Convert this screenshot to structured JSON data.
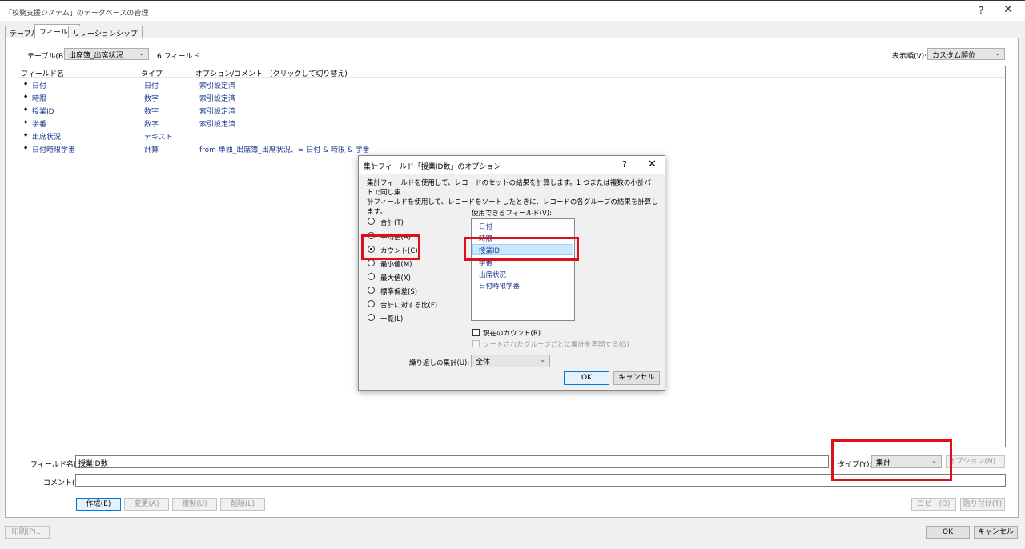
{
  "window": {
    "title": "「校務支援システム」のデータベースの管理",
    "help": "?",
    "close": "✕"
  },
  "tabs": [
    "テーブル",
    "フィールド",
    "リレーションシップ"
  ],
  "table_label": "テーブル(B):",
  "table_value": "出席簿_出席状況",
  "field_count": "6 フィールド",
  "sort_label": "表示順(V):",
  "sort_value": "カスタム順位",
  "list": {
    "headers": [
      "フィールド名",
      "タイプ",
      "オプション/コメント　(クリックして切り替え)"
    ],
    "rows": [
      {
        "name": "日付",
        "type": "日付",
        "option": "索引設定済"
      },
      {
        "name": "時限",
        "type": "数字",
        "option": "索引設定済"
      },
      {
        "name": "授業ID",
        "type": "数字",
        "option": "索引設定済"
      },
      {
        "name": "学番",
        "type": "数字",
        "option": "索引設定済"
      },
      {
        "name": "出席状況",
        "type": "テキスト",
        "option": ""
      },
      {
        "name": "日付時限学番",
        "type": "計算",
        "option": "from 単独_出席簿_出席状況、= 日付 & 時限 & 学番"
      }
    ]
  },
  "bottom": {
    "field_name_label": "フィールド名(F):",
    "field_name_value": "授業ID数",
    "type_label": "タイプ(Y):",
    "type_value": "集計",
    "options_button": "オプション(N)...",
    "comment_label": "コメント(C):",
    "comment_value": "",
    "create": "作成(E)",
    "change": "変更(A)",
    "duplicate": "複製(U)",
    "delete": "削除(L)",
    "copy": "コピー(O)",
    "paste": "貼り付け(T)",
    "print": "印刷(P)...",
    "ok": "OK",
    "cancel": "キャンセル"
  },
  "dialog": {
    "title": "集計フィールド「授業ID数」のオプション",
    "help": "?",
    "close": "✕",
    "desc1": "集計フィールドを使用して、レコードのセットの結果を計算します。1 つまたは複数の小計パートで同じ集",
    "desc2": "計フィールドを使用して、レコードをソートしたときに、レコードの各グループの結果を計算します。",
    "radios": [
      "合計(T)",
      "平均値(A)",
      "カウント(C)",
      "最小値(M)",
      "最大値(X)",
      "標準偏差(S)",
      "合計に対する比(F)",
      "一覧(L)"
    ],
    "available_label": "使用できるフィールド(V):",
    "fields": [
      "日付",
      "時限",
      "授業ID",
      "学番",
      "出席状況",
      "日付時限学番"
    ],
    "current_count": "現在のカウント(R)",
    "restart": "ソートされたグループごとに集計を再開する(G)",
    "repeat_label": "繰り返しの集計(U):",
    "repeat_value": "全体",
    "ok": "OK",
    "cancel": "キャンセル"
  },
  "colors": {
    "highlight": "#e0101a",
    "link_text": "#1c3a8c"
  }
}
